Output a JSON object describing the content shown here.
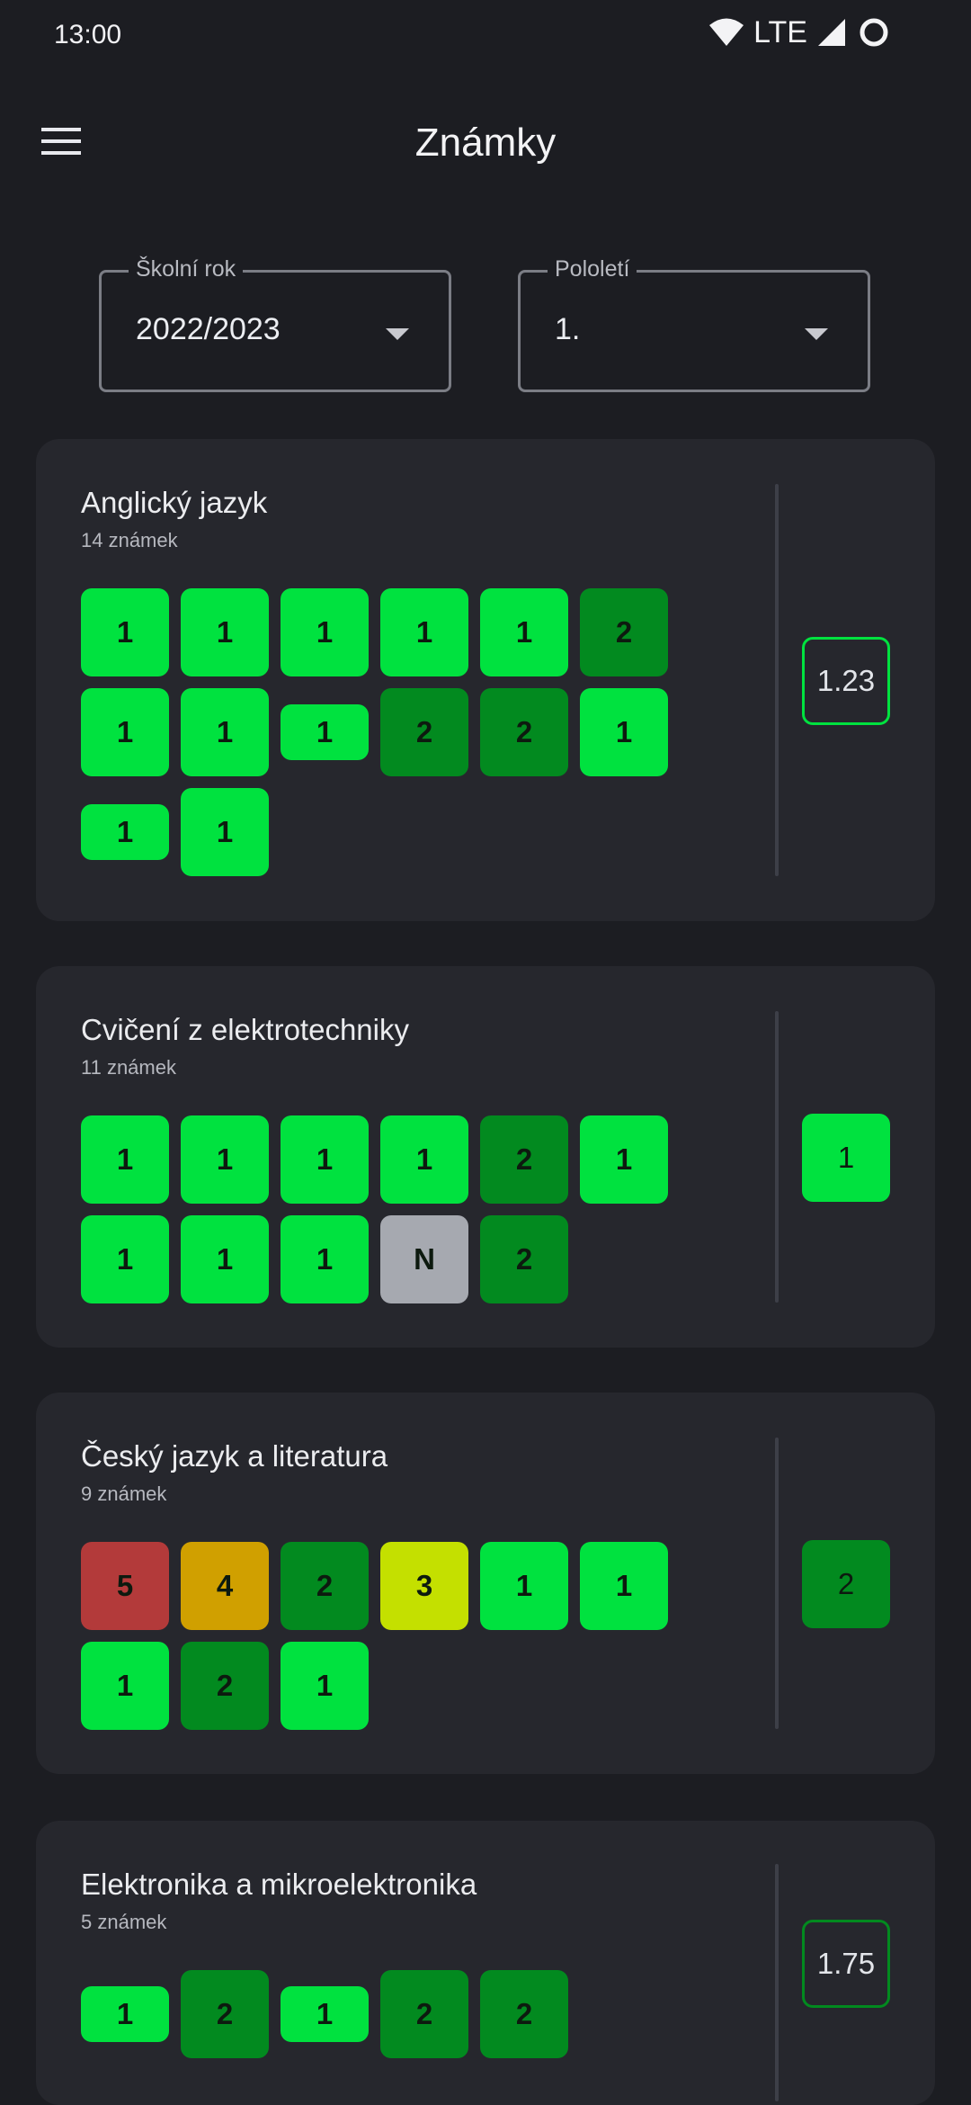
{
  "status": {
    "time": "13:00",
    "network": "LTE"
  },
  "app": {
    "title": "Známky"
  },
  "filters": {
    "year": {
      "label": "Školní rok",
      "value": "2022/2023"
    },
    "semester": {
      "label": "Pololetí",
      "value": "1."
    }
  },
  "colors": {
    "g1": "#00e23f",
    "g2": "#028a1f",
    "g3": "#c4e000",
    "g4": "#d0a000",
    "g5": "#b33a3a",
    "gN": "#a6a9b0"
  },
  "subjects": [
    {
      "name": "Anglický jazyk",
      "count": "14 známek",
      "avg": "1.23",
      "avg_style": "outline",
      "avg_color": "#00e23f",
      "grades": [
        {
          "v": "1",
          "c": "g1"
        },
        {
          "v": "1",
          "c": "g1"
        },
        {
          "v": "1",
          "c": "g1"
        },
        {
          "v": "1",
          "c": "g1"
        },
        {
          "v": "1",
          "c": "g1"
        },
        {
          "v": "2",
          "c": "g2"
        },
        {
          "v": "1",
          "c": "g1"
        },
        {
          "v": "1",
          "c": "g1"
        },
        {
          "v": "1",
          "c": "g1",
          "small": true
        },
        {
          "v": "2",
          "c": "g2"
        },
        {
          "v": "2",
          "c": "g2"
        },
        {
          "v": "1",
          "c": "g1"
        },
        {
          "v": "1",
          "c": "g1",
          "small": true
        },
        {
          "v": "1",
          "c": "g1"
        }
      ]
    },
    {
      "name": "Cvičení z elektrotechniky",
      "count": "11 známek",
      "avg": "1",
      "avg_style": "filled",
      "avg_color": "#00e23f",
      "grades": [
        {
          "v": "1",
          "c": "g1"
        },
        {
          "v": "1",
          "c": "g1"
        },
        {
          "v": "1",
          "c": "g1"
        },
        {
          "v": "1",
          "c": "g1"
        },
        {
          "v": "2",
          "c": "g2"
        },
        {
          "v": "1",
          "c": "g1"
        },
        {
          "v": "1",
          "c": "g1"
        },
        {
          "v": "1",
          "c": "g1"
        },
        {
          "v": "1",
          "c": "g1"
        },
        {
          "v": "N",
          "c": "gN"
        },
        {
          "v": "2",
          "c": "g2"
        }
      ]
    },
    {
      "name": "Český jazyk a literatura",
      "count": "9 známek",
      "avg": "2",
      "avg_style": "filled",
      "avg_color": "#028a1f",
      "grades": [
        {
          "v": "5",
          "c": "g5"
        },
        {
          "v": "4",
          "c": "g4"
        },
        {
          "v": "2",
          "c": "g2"
        },
        {
          "v": "3",
          "c": "g3"
        },
        {
          "v": "1",
          "c": "g1"
        },
        {
          "v": "1",
          "c": "g1"
        },
        {
          "v": "1",
          "c": "g1"
        },
        {
          "v": "2",
          "c": "g2"
        },
        {
          "v": "1",
          "c": "g1"
        }
      ]
    },
    {
      "name": "Elektronika a mikroelektronika",
      "count": "5 známek",
      "avg": "1.75",
      "avg_style": "outline",
      "avg_color": "#028a1f",
      "grades": [
        {
          "v": "1",
          "c": "g1",
          "small": true
        },
        {
          "v": "2",
          "c": "g2"
        },
        {
          "v": "1",
          "c": "g1",
          "small": true
        },
        {
          "v": "2",
          "c": "g2"
        },
        {
          "v": "2",
          "c": "g2"
        }
      ]
    }
  ]
}
